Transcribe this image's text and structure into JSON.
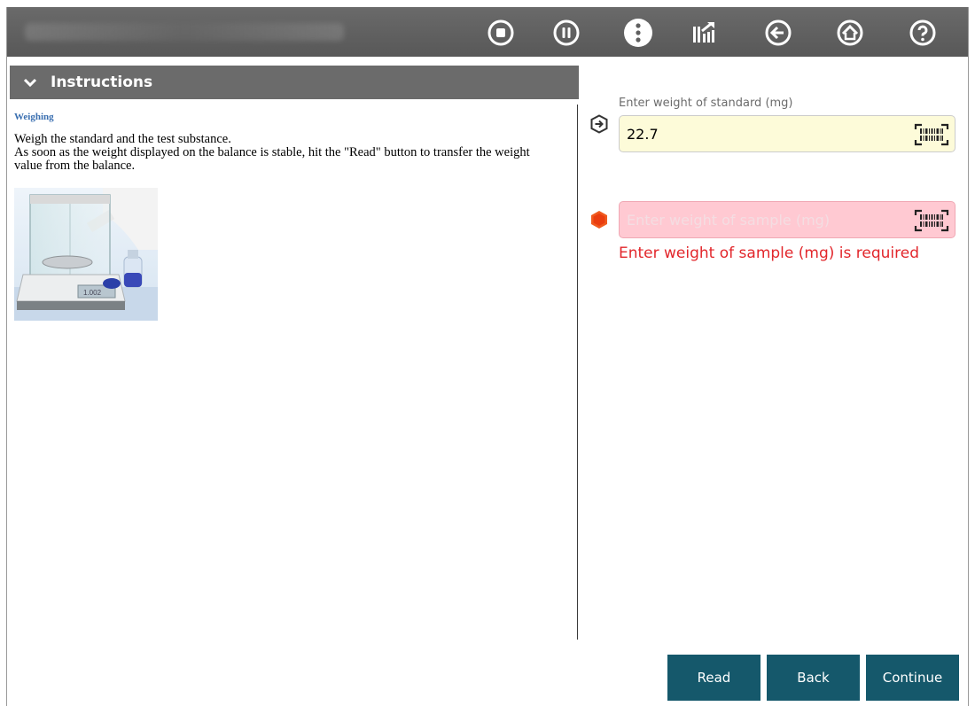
{
  "toolbar": {
    "icons": [
      "stop-icon",
      "pause-icon",
      "more-icon",
      "report-icon",
      "back-arrow-icon",
      "home-icon",
      "help-icon"
    ]
  },
  "instructions": {
    "header": "Instructions",
    "section_title": "Weighing",
    "lines": [
      "Weigh the standard and the test substance.",
      "As soon as the weight displayed on the balance is stable, hit the \"Read\" button to transfer the weight",
      "value from the balance."
    ]
  },
  "standard_field": {
    "label": "Enter weight of standard (mg)",
    "value": "22.7"
  },
  "sample_field": {
    "placeholder": "Enter weight of sample (mg)",
    "value": "",
    "error": "Enter weight of sample (mg) is required"
  },
  "buttons": {
    "read": "Read",
    "back": "Back",
    "continue": "Continue"
  },
  "colors": {
    "toolbar": "#5f5f5f",
    "header": "#6b6b6b",
    "button": "#15586b",
    "error": "#e2262b",
    "standard_bg": "#fdfbd9",
    "sample_bg": "#ffc9d2",
    "required_indicator": "#f05a1e"
  }
}
